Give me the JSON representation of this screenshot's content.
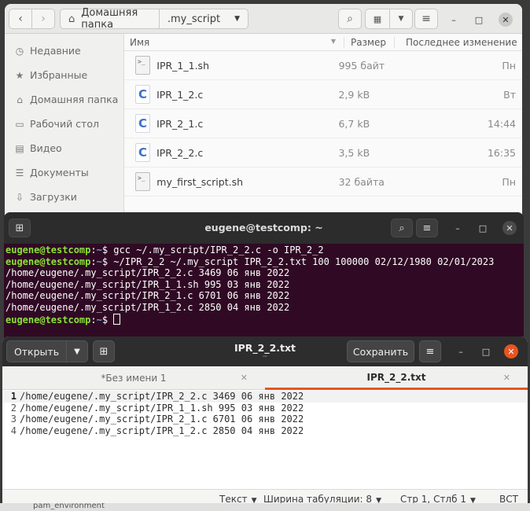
{
  "file_manager": {
    "breadcrumb": [
      "Домашняя папка",
      ".my_script"
    ],
    "sidebar": [
      {
        "icon": "clock-icon",
        "label": "Недавние"
      },
      {
        "icon": "star-icon",
        "label": "Избранные"
      },
      {
        "icon": "home-icon",
        "label": "Домашняя папка"
      },
      {
        "icon": "desktop-icon",
        "label": "Рабочий стол"
      },
      {
        "icon": "video-icon",
        "label": "Видео"
      },
      {
        "icon": "document-icon",
        "label": "Документы"
      },
      {
        "icon": "download-icon",
        "label": "Загрузки"
      }
    ],
    "columns": {
      "name": "Имя",
      "size": "Размер",
      "modified": "Последнее изменение"
    },
    "files": [
      {
        "type": "sh",
        "name": "IPR_1_1.sh",
        "size": "995 байт",
        "modified": "Пн"
      },
      {
        "type": "c",
        "name": "IPR_1_2.c",
        "size": "2,9 kB",
        "modified": "Вт"
      },
      {
        "type": "c",
        "name": "IPR_2_1.c",
        "size": "6,7 kB",
        "modified": "14:44"
      },
      {
        "type": "c",
        "name": "IPR_2_2.c",
        "size": "3,5 kB",
        "modified": "16:35"
      },
      {
        "type": "sh",
        "name": "my_first_script.sh",
        "size": "32 байта",
        "modified": "Пн"
      }
    ]
  },
  "terminal": {
    "title": "eugene@testcomp: ~",
    "prompt_user": "eugene@testcomp",
    "prompt_path": "~",
    "lines": [
      {
        "kind": "cmd",
        "text": "$ gcc ~/.my_script/IPR_2_2.c -o IPR_2_2"
      },
      {
        "kind": "cmd",
        "text": "$ ~/IPR_2_2 ~/.my_script IPR_2_2.txt 100 100000 02/12/1980 02/01/2023"
      },
      {
        "kind": "out",
        "text": "/home/eugene/.my_script/IPR_2_2.c 3469 06 янв 2022"
      },
      {
        "kind": "out",
        "text": "/home/eugene/.my_script/IPR_1_1.sh 995 03 янв 2022"
      },
      {
        "kind": "out",
        "text": "/home/eugene/.my_script/IPR_2_1.c 6701 06 янв 2022"
      },
      {
        "kind": "out",
        "text": "/home/eugene/.my_script/IPR_1_2.c 2850 04 янв 2022"
      },
      {
        "kind": "prompt",
        "text": "$ "
      }
    ]
  },
  "editor": {
    "open_label": "Открыть",
    "title": "IPR_2_2.txt",
    "title_sub": "~",
    "save_label": "Сохранить",
    "tabs": [
      {
        "label": "*Без имени 1",
        "active": false
      },
      {
        "label": "IPR_2_2.txt",
        "active": true
      }
    ],
    "lines": [
      {
        "num": "1",
        "text": "/home/eugene/.my_script/IPR_2_2.c 3469 06 янв 2022"
      },
      {
        "num": "2",
        "text": "/home/eugene/.my_script/IPR_1_1.sh 995 03 янв 2022"
      },
      {
        "num": "3",
        "text": "/home/eugene/.my_script/IPR_2_1.c 6701 06 янв 2022"
      },
      {
        "num": "4",
        "text": "/home/eugene/.my_script/IPR_1_2.c 2850 04 янв 2022"
      }
    ],
    "status": {
      "syntax": "Текст",
      "tab_width": "Ширина табуляции: 8",
      "position": "Стр 1, Стлб 1",
      "mode": "ВСТ"
    }
  },
  "background_peek": "pam_environment",
  "colors": {
    "accent": "#e95420",
    "terminal_bg": "#300a24",
    "prompt_user": "#8ae234",
    "prompt_path": "#729fcf"
  }
}
